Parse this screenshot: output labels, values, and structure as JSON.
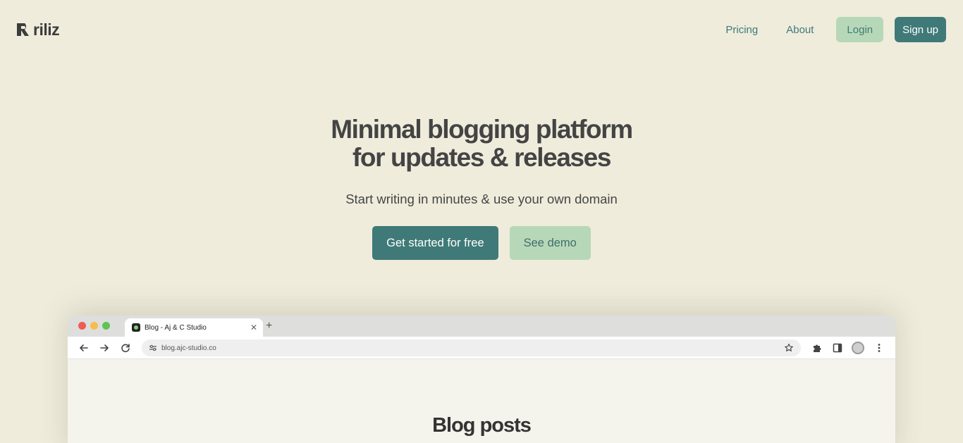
{
  "brand": {
    "name": "riliz"
  },
  "nav": {
    "pricing": "Pricing",
    "about": "About",
    "login": "Login",
    "signup": "Sign up"
  },
  "hero": {
    "title_line1": "Minimal blogging platform",
    "title_line2": "for updates & releases",
    "subtitle": "Start writing in minutes & use your own domain",
    "cta_primary": "Get started for free",
    "cta_secondary": "See demo"
  },
  "mockup": {
    "tab_title": "Blog - Aj & C Studio",
    "url": "blog.ajc-studio.co",
    "page_heading": "Blog posts"
  },
  "colors": {
    "background": "#efecdc",
    "primary": "#3f7a78",
    "secondary": "#b7d8b8"
  }
}
